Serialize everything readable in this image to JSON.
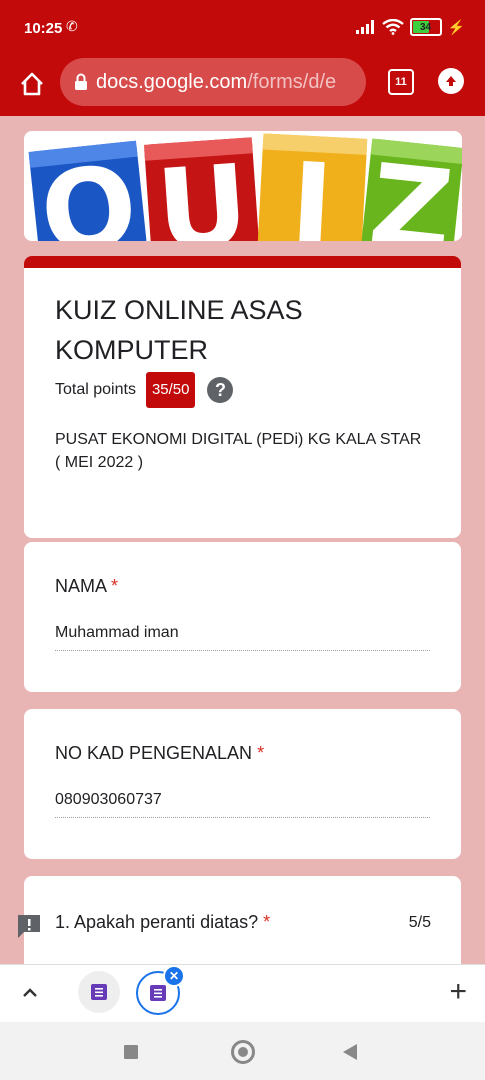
{
  "status_bar": {
    "time": "10:25",
    "battery": "34"
  },
  "browser": {
    "url_main": "docs.google.com",
    "url_path": "/forms/d/e",
    "tab_count": "11"
  },
  "banner": {
    "letters": [
      "Q",
      "U",
      "I",
      "Z"
    ]
  },
  "form": {
    "title": "KUIZ ONLINE ASAS KOMPUTER",
    "points_label": "Total points",
    "points_value": "35/50",
    "help_symbol": "?",
    "description_line1": "PUSAT EKONOMI DIGITAL (PEDi) KG KALA STAR",
    "description_line2": "( MEI 2022 )"
  },
  "fields": [
    {
      "label": "NAMA",
      "value": "Muhammad iman"
    },
    {
      "label": "NO KAD PENGENALAN",
      "value": "080903060737"
    }
  ],
  "required_mark": "*",
  "question1": {
    "label": "1. Apakah peranti diatas?",
    "score": "5/5"
  },
  "bottom_bar": {
    "plus": "+"
  },
  "colors": {
    "theme": "#c20a0a",
    "background": "#e8b4b4"
  }
}
